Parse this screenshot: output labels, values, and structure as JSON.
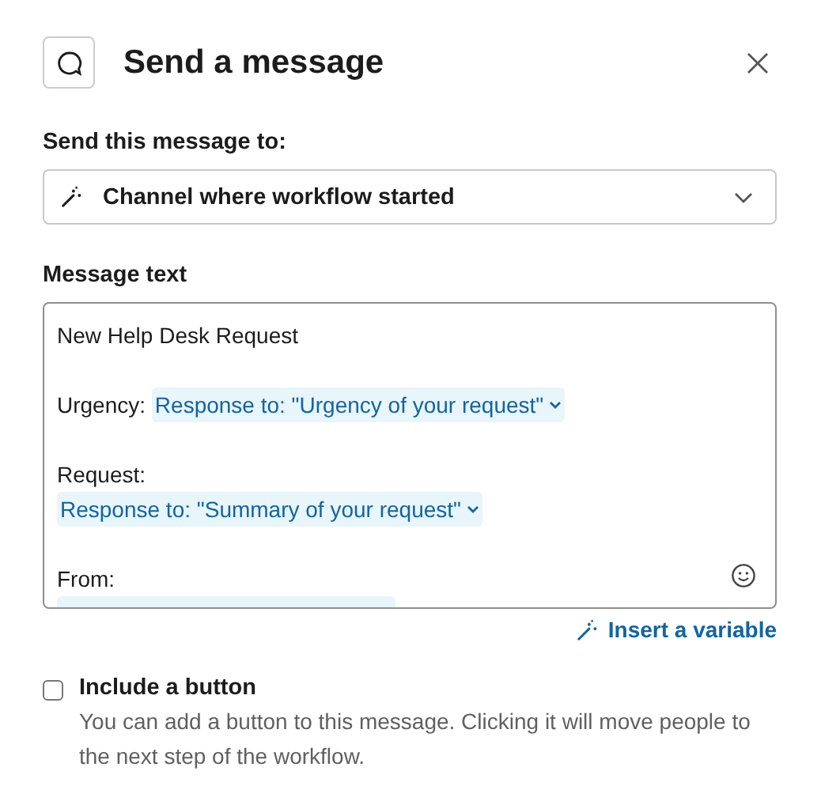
{
  "dialog": {
    "title": "Send a message"
  },
  "recipient": {
    "label": "Send this message to:",
    "value": "Channel where workflow started"
  },
  "message": {
    "label": "Message text",
    "paragraphs": [
      [
        [
          {
            "kind": "text",
            "text": "New Help Desk Request"
          }
        ]
      ],
      [
        [
          {
            "kind": "text",
            "text": "Urgency: "
          },
          {
            "kind": "variable",
            "text": "Response to: \"Urgency of your request\""
          }
        ]
      ],
      [
        [
          {
            "kind": "text",
            "text": "Request:"
          }
        ],
        [
          {
            "kind": "variable",
            "text": "Response to: \"Summary of your request\""
          }
        ]
      ],
      [
        [
          {
            "kind": "text",
            "text": "From:"
          }
        ],
        [
          {
            "kind": "variable"
          }
        ]
      ]
    ]
  },
  "insert_variable": "Insert a variable",
  "include_button": {
    "label": "Include a button",
    "checked": false,
    "description": "You can add a button to this message. Clicking it will move people to the next step of the workflow."
  }
}
